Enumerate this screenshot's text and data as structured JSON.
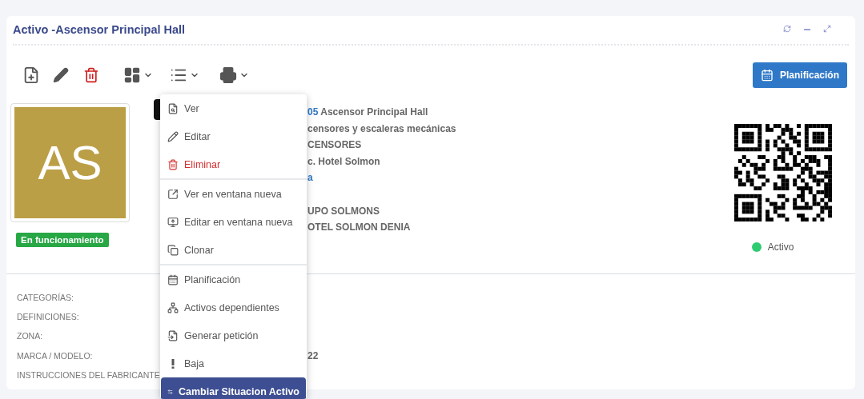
{
  "panel": {
    "title": "Activo -Ascensor Principal Hall"
  },
  "planning_button": {
    "label": "Planificación"
  },
  "avatar": {
    "initials": "AS",
    "color": "#bb9f46"
  },
  "status_badge": {
    "label": "En funcionamiento"
  },
  "details": [
    [
      [
        {
          "kind": "link",
          "text": "05"
        },
        {
          "kind": "text",
          "text": " Ascensor Principal Hall"
        }
      ],
      [
        {
          "kind": "text",
          "text": "censores y escaleras mecánicas"
        }
      ],
      [
        {
          "kind": "text",
          "text": "CENSORES"
        }
      ],
      [
        {
          "kind": "text",
          "text": "c. Hotel Solmon"
        }
      ],
      [
        {
          "kind": "link",
          "text": "a"
        }
      ]
    ],
    [
      [
        {
          "kind": "text",
          "text": "UPO SOLMONS"
        }
      ],
      [
        {
          "kind": "text",
          "text": "OTEL SOLMON DENIA"
        }
      ]
    ]
  ],
  "state": {
    "label": "Activo",
    "active": true
  },
  "fields": [
    {
      "label": "CATEGORÍAS:"
    },
    {
      "label": "DEFINICIONES:"
    },
    {
      "label": "ZONA:"
    },
    {
      "label": "MARCA / MODELO:",
      "value": "22"
    },
    {
      "label": "INSTRUCCIONES DEL FABRICANTE:"
    }
  ],
  "menu": {
    "sections": [
      [
        {
          "label": "Ver",
          "danger": false,
          "selected": false
        },
        {
          "label": "Editar",
          "danger": false,
          "selected": false
        },
        {
          "label": "Eliminar",
          "danger": true,
          "selected": false
        }
      ],
      [
        {
          "label": "Ver en ventana nueva",
          "danger": false,
          "selected": false
        },
        {
          "label": "Editar en ventana nueva",
          "danger": false,
          "selected": false
        },
        {
          "label": "Clonar",
          "danger": false,
          "selected": false
        }
      ],
      [
        {
          "label": "Planificación",
          "danger": false,
          "selected": false
        },
        {
          "label": "Activos dependientes",
          "danger": false,
          "selected": false
        },
        {
          "label": "Generar petición",
          "danger": false,
          "selected": false
        },
        {
          "label": "Baja",
          "danger": false,
          "selected": false
        },
        {
          "label": "Cambiar Situacion Activo",
          "danger": false,
          "selected": true
        }
      ]
    ]
  }
}
